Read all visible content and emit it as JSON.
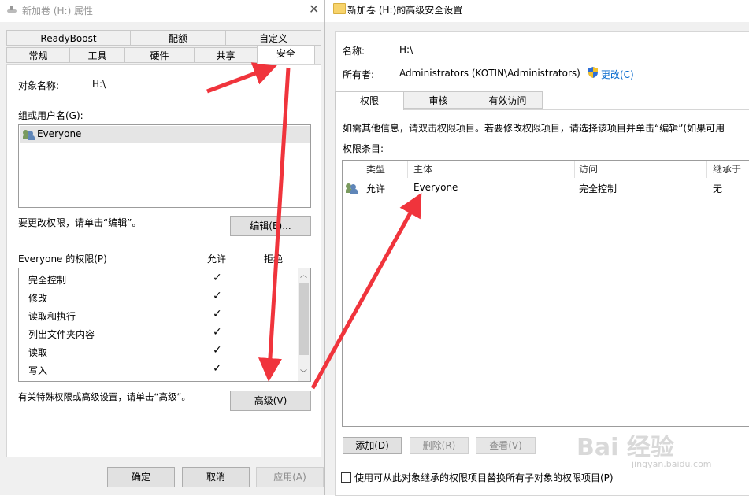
{
  "left_dialog": {
    "title": "新加卷 (H:) 属性",
    "tabs_row1": [
      "ReadyBoost",
      "配额",
      "自定义"
    ],
    "tabs_row2": [
      "常规",
      "工具",
      "硬件",
      "共享",
      "安全"
    ],
    "object_name_label": "对象名称:",
    "object_name_value": "H:\\",
    "group_label": "组或用户名(G):",
    "users": [
      "Everyone"
    ],
    "change_perm_text": "要更改权限，请单击“编辑”。",
    "edit_button": "编辑(E)...",
    "perm_title": "Everyone 的权限(P)",
    "allow_header": "允许",
    "deny_header": "拒绝",
    "permissions": [
      {
        "name": "完全控制",
        "allow": "✓"
      },
      {
        "name": "修改",
        "allow": "✓"
      },
      {
        "name": "读取和执行",
        "allow": "✓"
      },
      {
        "name": "列出文件夹内容",
        "allow": "✓"
      },
      {
        "name": "读取",
        "allow": "✓"
      },
      {
        "name": "写入",
        "allow": "✓"
      }
    ],
    "advanced_text": "有关特殊权限或高级设置，请单击“高级”。",
    "advanced_button": "高级(V)",
    "ok_button": "确定",
    "cancel_button": "取消",
    "apply_button": "应用(A)"
  },
  "right_window": {
    "title": "新加卷 (H:)的高级安全设置",
    "name_label": "名称:",
    "name_value": "H:\\",
    "owner_label": "所有者:",
    "owner_value": "Administrators (KOTIN\\Administrators)",
    "change_link": "更改(C)",
    "tabs": [
      "权限",
      "审核",
      "有效访问"
    ],
    "info_text": "如需其他信息，请双击权限项目。若要修改权限项目，请选择该项目并单击“编辑”(如果可用",
    "entries_label": "权限条目:",
    "columns": [
      "类型",
      "主体",
      "访问",
      "继承于"
    ],
    "rows": [
      {
        "type": "允许",
        "principal": "Everyone",
        "access": "完全控制",
        "inherited": "无"
      }
    ],
    "add_button": "添加(D)",
    "remove_button": "删除(R)",
    "view_button": "查看(V)",
    "replace_checkbox_label": "使用可从此对象继承的权限项目替换所有子对象的权限项目(P)"
  },
  "watermark": {
    "text": "Bai 经验",
    "sub": "jingyan.baidu.com"
  },
  "colors": {
    "arrow": "#f0343c",
    "link": "#0066cc"
  }
}
